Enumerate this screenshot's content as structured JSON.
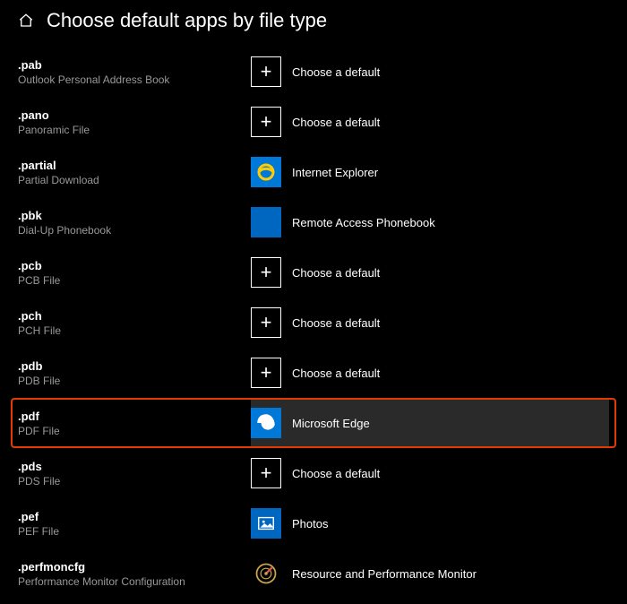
{
  "header": {
    "title": "Choose default apps by file type"
  },
  "labels": {
    "choose_default": "Choose a default"
  },
  "apps": {
    "ie": "Internet Explorer",
    "remote_phonebook": "Remote Access Phonebook",
    "edge": "Microsoft Edge",
    "photos": "Photos",
    "perfmon": "Resource and Performance Monitor"
  },
  "rows": [
    {
      "ext": ".pab",
      "desc": "Outlook Personal Address Book",
      "app": null,
      "icon": "plus"
    },
    {
      "ext": ".pano",
      "desc": "Panoramic File",
      "app": null,
      "icon": "plus"
    },
    {
      "ext": ".partial",
      "desc": "Partial Download",
      "app": "ie",
      "icon": "ie"
    },
    {
      "ext": ".pbk",
      "desc": "Dial-Up Phonebook",
      "app": "remote_phonebook",
      "icon": "blank"
    },
    {
      "ext": ".pcb",
      "desc": "PCB File",
      "app": null,
      "icon": "plus"
    },
    {
      "ext": ".pch",
      "desc": "PCH File",
      "app": null,
      "icon": "plus"
    },
    {
      "ext": ".pdb",
      "desc": "PDB File",
      "app": null,
      "icon": "plus"
    },
    {
      "ext": ".pdf",
      "desc": "PDF File",
      "app": "edge",
      "icon": "edge",
      "highlight": true
    },
    {
      "ext": ".pds",
      "desc": "PDS File",
      "app": null,
      "icon": "plus"
    },
    {
      "ext": ".pef",
      "desc": "PEF File",
      "app": "photos",
      "icon": "photos"
    },
    {
      "ext": ".perfmoncfg",
      "desc": "Performance Monitor Configuration",
      "app": "perfmon",
      "icon": "perfmon"
    }
  ]
}
